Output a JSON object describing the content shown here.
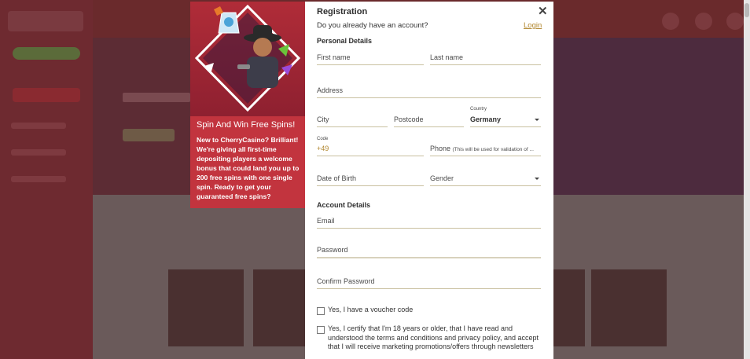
{
  "registration": {
    "title": "Registration",
    "close_icon": "close-icon",
    "have_account": "Do you already have an account?",
    "login_link": "Login",
    "personal_details": "Personal Details",
    "fields": {
      "first_name": "First name",
      "last_name": "Last name",
      "address": "Address",
      "city": "City",
      "postcode": "Postcode",
      "country_label": "Country",
      "country_value": "Germany",
      "code_label": "Code",
      "code_value": "+49",
      "phone_label": "Phone",
      "phone_note": "(This will be used for validation of ...",
      "dob": "Date of Birth",
      "gender": "Gender",
      "email": "Email",
      "password": "Password",
      "confirm_password": "Confirm Password"
    },
    "account_details": "Account Details",
    "voucher_checkbox": "Yes, I have a voucher code",
    "terms_checkbox": "Yes, I certify that I'm 18 years or older, that I have read and understood the terms and conditions and privacy policy, and accept that I will receive marketing promotions/offers through newsletters"
  },
  "promo": {
    "title": "Spin And Win Free Spins!",
    "text": "New to CherryCasino? Brilliant! We're giving all first-time depositing players a welcome bonus that could land you up to 200 free spins with one single spin. Ready to get your guaranteed free spins?",
    "image": "cowboy-mascot-illustration"
  },
  "colors": {
    "accent_gold": "#b0852c",
    "promo_red": "#c2343e",
    "field_underline": "#c9c0a0"
  }
}
